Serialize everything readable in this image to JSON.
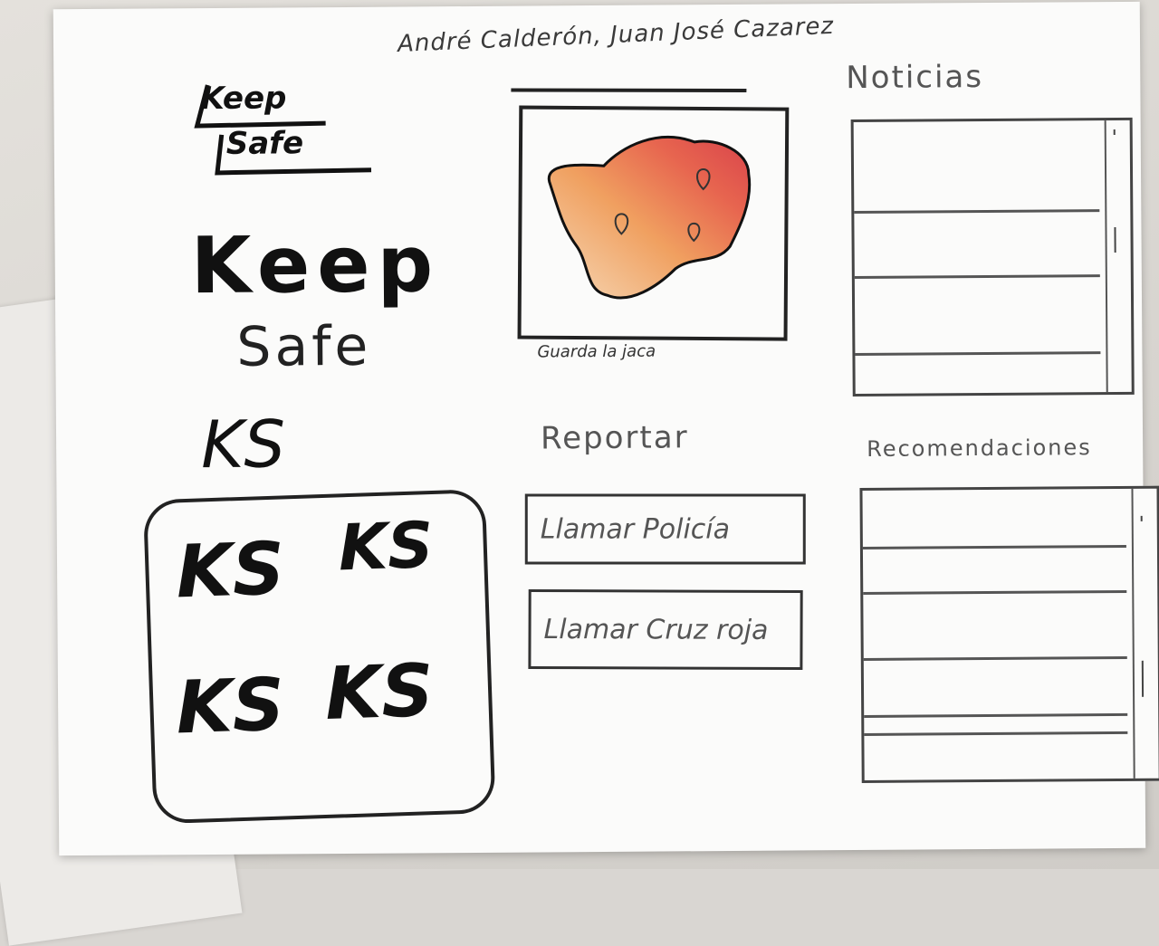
{
  "authors": "André Calderón, Juan José Cazarez",
  "logo": {
    "line1": "Keep",
    "line2": "Safe"
  },
  "branding_options": {
    "keep": "Keep",
    "safe": "Safe",
    "ks": "KS",
    "ks_grid": [
      "KS",
      "KS",
      "KS",
      "KS"
    ]
  },
  "map": {
    "caption": "Guarda la jaca",
    "pins": 3
  },
  "news": {
    "title": "Noticias",
    "rows": 3
  },
  "report": {
    "title": "Reportar",
    "buttons": [
      "Llamar Policía",
      "Llamar Cruz roja"
    ]
  },
  "recommendations": {
    "title": "Recomendaciones",
    "rows": 5
  },
  "colors": {
    "ink": "#222222",
    "map_red": "#d9434b",
    "map_orange": "#f0a060",
    "paper": "#fbfbfa"
  }
}
